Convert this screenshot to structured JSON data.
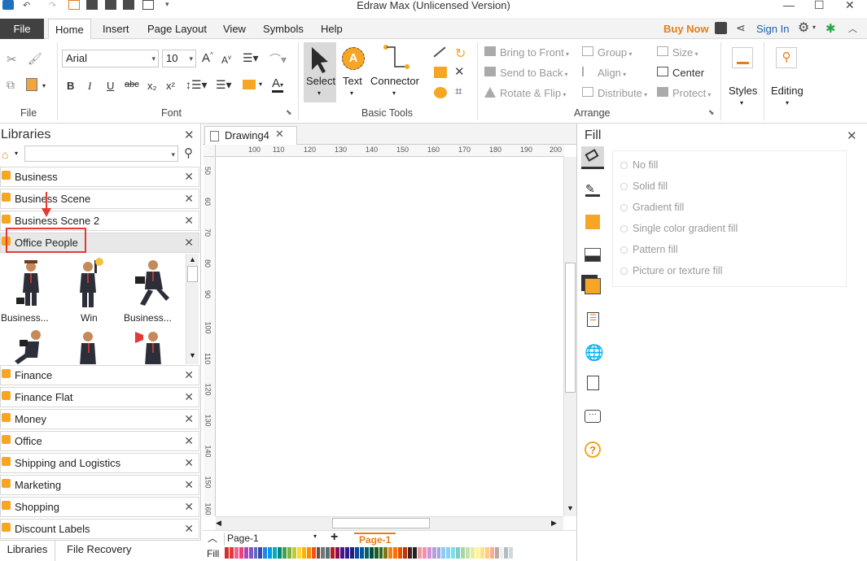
{
  "window": {
    "title": "Edraw Max (Unlicensed Version)"
  },
  "menu": {
    "file": "File",
    "tabs": [
      "Home",
      "Insert",
      "Page Layout",
      "View",
      "Symbols",
      "Help"
    ],
    "buy_now": "Buy Now",
    "sign_in": "Sign In"
  },
  "ribbon": {
    "font_name": "Arial",
    "font_size": "10",
    "groups": {
      "file": "File",
      "font": "Font",
      "basic_tools": "Basic Tools",
      "arrange": "Arrange"
    },
    "tools": {
      "select": "Select",
      "text": "Text",
      "connector": "Connector"
    },
    "arrange": {
      "bring_to_front": "Bring to Front",
      "send_to_back": "Send to Back",
      "rotate_flip": "Rotate & Flip",
      "group": "Group",
      "align": "Align",
      "distribute": "Distribute",
      "size": "Size",
      "center": "Center",
      "protect": "Protect"
    },
    "styles": "Styles",
    "editing": "Editing",
    "format_buttons": [
      "B",
      "I",
      "U",
      "abc",
      "x₂",
      "x²"
    ],
    "text_icon": "A",
    "font_color_glyph": "A"
  },
  "libraries": {
    "title": "Libraries",
    "search_placeholder": "",
    "items": [
      {
        "label": "Business"
      },
      {
        "label": "Business Scene"
      },
      {
        "label": "Business Scene 2"
      },
      {
        "label": "Office People"
      }
    ],
    "shapes": [
      {
        "label": "Business..."
      },
      {
        "label": "Win"
      },
      {
        "label": "Business..."
      }
    ],
    "more_items": [
      {
        "label": "Finance"
      },
      {
        "label": "Finance Flat"
      },
      {
        "label": "Money"
      },
      {
        "label": "Office"
      },
      {
        "label": "Shipping and Logistics"
      },
      {
        "label": "Marketing"
      },
      {
        "label": "Shopping"
      },
      {
        "label": "Discount Labels"
      }
    ],
    "bottom_tabs": [
      "Libraries",
      "File Recovery"
    ]
  },
  "document": {
    "tab": "Drawing4",
    "ruler_top": [
      "100",
      "110",
      "120",
      "130",
      "140",
      "150",
      "160",
      "170",
      "180",
      "190",
      "200"
    ],
    "ruler_left": [
      "50",
      "60",
      "70",
      "80",
      "90",
      "100",
      "110",
      "120",
      "130",
      "140",
      "150",
      "160"
    ],
    "page_select": "Page-1",
    "page_tab": "Page-1",
    "fill_label": "Fill"
  },
  "fill_panel": {
    "title": "Fill",
    "options": [
      "No fill",
      "Solid fill",
      "Gradient fill",
      "Single color gradient fill",
      "Pattern fill",
      "Picture or texture fill"
    ]
  },
  "palette": [
    "#d32f2f",
    "#e53935",
    "#f06292",
    "#ec407a",
    "#ab47bc",
    "#7e57c2",
    "#5c6bc0",
    "#3949ab",
    "#1e88e5",
    "#039be5",
    "#00acc1",
    "#00897b",
    "#43a047",
    "#7cb342",
    "#c0ca33",
    "#fdd835",
    "#ffb300",
    "#fb8c00",
    "#f4511e",
    "#6d4c41",
    "#757575",
    "#546e7a",
    "#b71c1c",
    "#880e4f",
    "#4a148c",
    "#311b92",
    "#1a237e",
    "#0d47a1",
    "#01579b",
    "#006064",
    "#004d40",
    "#1b5e20",
    "#33691e",
    "#827717",
    "#f57f17",
    "#ff6f00",
    "#e65100",
    "#bf360c",
    "#3e2723",
    "#212121",
    "#ef9a9a",
    "#f48fb1",
    "#ce93d8",
    "#b39ddb",
    "#9fa8da",
    "#90caf9",
    "#81d4fa",
    "#80deea",
    "#80cbc4",
    "#a5d6a7",
    "#c5e1a5",
    "#e6ee9c",
    "#fff59d",
    "#ffe082",
    "#ffcc80",
    "#ffab91",
    "#bcaaa4",
    "#eeeeee",
    "#b0bec5",
    "#cfd8dc"
  ],
  "colors": {
    "accent": "#e57e16",
    "annotation": "#e53935",
    "file_tab": "#414141"
  }
}
